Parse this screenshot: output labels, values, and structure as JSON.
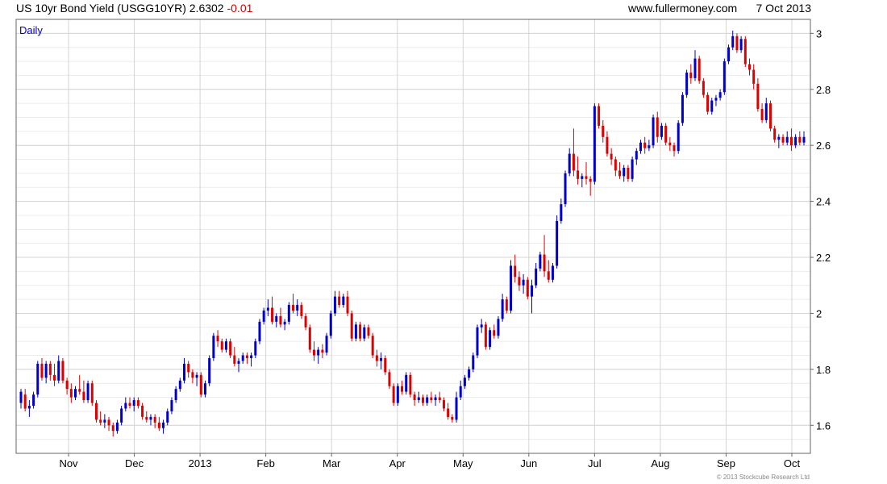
{
  "header": {
    "instrument": "US 10yr Bond Yield (USGG10YR)",
    "last": "2.6302",
    "change": "-0.01",
    "source": "www.fullermoney.com",
    "date": "7 Oct 2013"
  },
  "footer": {
    "copyright": "© 2013 Stockcube Research Ltd"
  },
  "colors": {
    "up": "#0000cc",
    "down": "#dd0000",
    "grid": "#d4d4d4",
    "gridMinor": "#ececec",
    "frame": "#666666",
    "label": "#0000cc"
  },
  "chart_data": {
    "type": "candlestick",
    "panel_label": "Daily",
    "x_tick_labels": [
      "Nov",
      "Dec",
      "2013",
      "Feb",
      "Mar",
      "Apr",
      "May",
      "Jun",
      "Jul",
      "Aug",
      "Sep",
      "Oct"
    ],
    "y_ticks": [
      "1.6",
      "1.8",
      "2",
      "2.2",
      "2.4",
      "2.6",
      "2.8",
      "3"
    ],
    "ylim": [
      1.5,
      3.05
    ],
    "y_axis_side": "right",
    "grid": true,
    "series": [
      {
        "name": "daily",
        "values": [
          [
            1.68,
            1.73,
            1.66,
            1.72
          ],
          [
            1.71,
            1.73,
            1.65,
            1.66
          ],
          [
            1.66,
            1.69,
            1.63,
            1.67
          ],
          [
            1.67,
            1.72,
            1.66,
            1.71
          ],
          [
            1.71,
            1.83,
            1.7,
            1.82
          ],
          [
            1.82,
            1.84,
            1.76,
            1.77
          ],
          [
            1.77,
            1.83,
            1.75,
            1.82
          ],
          [
            1.82,
            1.83,
            1.76,
            1.78
          ],
          [
            1.78,
            1.82,
            1.74,
            1.76
          ],
          [
            1.76,
            1.85,
            1.75,
            1.83
          ],
          [
            1.83,
            1.84,
            1.75,
            1.76
          ],
          [
            1.76,
            1.77,
            1.71,
            1.73
          ],
          [
            1.73,
            1.75,
            1.68,
            1.7
          ],
          [
            1.7,
            1.74,
            1.69,
            1.73
          ],
          [
            1.73,
            1.78,
            1.71,
            1.72
          ],
          [
            1.72,
            1.76,
            1.68,
            1.69
          ],
          [
            1.69,
            1.76,
            1.68,
            1.75
          ],
          [
            1.75,
            1.76,
            1.67,
            1.68
          ],
          [
            1.68,
            1.69,
            1.61,
            1.62
          ],
          [
            1.62,
            1.65,
            1.6,
            1.61
          ],
          [
            1.61,
            1.64,
            1.59,
            1.62
          ],
          [
            1.62,
            1.63,
            1.58,
            1.6
          ],
          [
            1.6,
            1.61,
            1.56,
            1.58
          ],
          [
            1.58,
            1.62,
            1.57,
            1.61
          ],
          [
            1.61,
            1.67,
            1.6,
            1.66
          ],
          [
            1.66,
            1.7,
            1.65,
            1.68
          ],
          [
            1.68,
            1.7,
            1.66,
            1.67
          ],
          [
            1.67,
            1.7,
            1.65,
            1.69
          ],
          [
            1.69,
            1.7,
            1.66,
            1.67
          ],
          [
            1.67,
            1.68,
            1.62,
            1.63
          ],
          [
            1.63,
            1.65,
            1.61,
            1.62
          ],
          [
            1.62,
            1.64,
            1.6,
            1.63
          ],
          [
            1.63,
            1.64,
            1.59,
            1.61
          ],
          [
            1.61,
            1.63,
            1.58,
            1.59
          ],
          [
            1.59,
            1.62,
            1.57,
            1.61
          ],
          [
            1.61,
            1.66,
            1.6,
            1.65
          ],
          [
            1.65,
            1.7,
            1.64,
            1.69
          ],
          [
            1.69,
            1.74,
            1.68,
            1.73
          ],
          [
            1.73,
            1.77,
            1.72,
            1.76
          ],
          [
            1.76,
            1.84,
            1.75,
            1.82
          ],
          [
            1.82,
            1.83,
            1.77,
            1.79
          ],
          [
            1.79,
            1.8,
            1.75,
            1.77
          ],
          [
            1.77,
            1.79,
            1.74,
            1.78
          ],
          [
            1.78,
            1.79,
            1.7,
            1.71
          ],
          [
            1.71,
            1.76,
            1.7,
            1.75
          ],
          [
            1.75,
            1.85,
            1.74,
            1.84
          ],
          [
            1.84,
            1.93,
            1.83,
            1.92
          ],
          [
            1.92,
            1.94,
            1.88,
            1.9
          ],
          [
            1.9,
            1.91,
            1.86,
            1.87
          ],
          [
            1.87,
            1.91,
            1.86,
            1.9
          ],
          [
            1.9,
            1.91,
            1.84,
            1.85
          ],
          [
            1.85,
            1.88,
            1.81,
            1.82
          ],
          [
            1.82,
            1.84,
            1.79,
            1.83
          ],
          [
            1.83,
            1.86,
            1.82,
            1.85
          ],
          [
            1.85,
            1.86,
            1.82,
            1.84
          ],
          [
            1.84,
            1.86,
            1.81,
            1.85
          ],
          [
            1.85,
            1.91,
            1.84,
            1.9
          ],
          [
            1.9,
            1.98,
            1.89,
            1.97
          ],
          [
            1.97,
            2.02,
            1.96,
            2.01
          ],
          [
            2.01,
            2.05,
            1.99,
            2.02
          ],
          [
            2.02,
            2.06,
            1.96,
            1.97
          ],
          [
            1.97,
            2.0,
            1.95,
            1.99
          ],
          [
            1.99,
            2.02,
            1.95,
            1.96
          ],
          [
            1.96,
            1.98,
            1.94,
            1.97
          ],
          [
            1.97,
            2.04,
            1.96,
            2.03
          ],
          [
            2.03,
            2.07,
            2.0,
            2.01
          ],
          [
            2.01,
            2.05,
            1.99,
            2.03
          ],
          [
            2.03,
            2.04,
            1.98,
            1.99
          ],
          [
            1.99,
            2.0,
            1.94,
            1.95
          ],
          [
            1.95,
            1.96,
            1.86,
            1.87
          ],
          [
            1.87,
            1.9,
            1.83,
            1.85
          ],
          [
            1.85,
            1.88,
            1.82,
            1.87
          ],
          [
            1.87,
            1.89,
            1.84,
            1.86
          ],
          [
            1.86,
            1.93,
            1.85,
            1.92
          ],
          [
            1.92,
            2.01,
            1.91,
            2.0
          ],
          [
            2.0,
            2.08,
            1.99,
            2.06
          ],
          [
            2.06,
            2.08,
            2.02,
            2.03
          ],
          [
            2.03,
            2.07,
            2.02,
            2.06
          ],
          [
            2.06,
            2.08,
            1.99,
            2.0
          ],
          [
            2.0,
            2.01,
            1.9,
            1.91
          ],
          [
            1.91,
            1.97,
            1.9,
            1.96
          ],
          [
            1.96,
            1.97,
            1.9,
            1.91
          ],
          [
            1.91,
            1.96,
            1.9,
            1.95
          ],
          [
            1.95,
            1.96,
            1.91,
            1.92
          ],
          [
            1.92,
            1.93,
            1.84,
            1.85
          ],
          [
            1.85,
            1.87,
            1.81,
            1.83
          ],
          [
            1.83,
            1.86,
            1.8,
            1.84
          ],
          [
            1.84,
            1.85,
            1.78,
            1.79
          ],
          [
            1.79,
            1.8,
            1.73,
            1.74
          ],
          [
            1.74,
            1.75,
            1.67,
            1.68
          ],
          [
            1.68,
            1.75,
            1.67,
            1.74
          ],
          [
            1.74,
            1.76,
            1.71,
            1.72
          ],
          [
            1.72,
            1.79,
            1.71,
            1.78
          ],
          [
            1.78,
            1.79,
            1.7,
            1.71
          ],
          [
            1.71,
            1.72,
            1.67,
            1.69
          ],
          [
            1.69,
            1.72,
            1.68,
            1.7
          ],
          [
            1.7,
            1.71,
            1.67,
            1.68
          ],
          [
            1.68,
            1.71,
            1.67,
            1.7
          ],
          [
            1.7,
            1.72,
            1.68,
            1.69
          ],
          [
            1.69,
            1.71,
            1.67,
            1.7
          ],
          [
            1.7,
            1.72,
            1.68,
            1.69
          ],
          [
            1.69,
            1.7,
            1.65,
            1.66
          ],
          [
            1.66,
            1.68,
            1.62,
            1.63
          ],
          [
            1.63,
            1.64,
            1.61,
            1.62
          ],
          [
            1.62,
            1.72,
            1.61,
            1.7
          ],
          [
            1.7,
            1.76,
            1.69,
            1.74
          ],
          [
            1.74,
            1.78,
            1.73,
            1.77
          ],
          [
            1.77,
            1.81,
            1.76,
            1.8
          ],
          [
            1.8,
            1.86,
            1.79,
            1.85
          ],
          [
            1.85,
            1.96,
            1.84,
            1.95
          ],
          [
            1.95,
            1.98,
            1.93,
            1.96
          ],
          [
            1.96,
            1.97,
            1.87,
            1.88
          ],
          [
            1.88,
            1.95,
            1.87,
            1.94
          ],
          [
            1.94,
            1.96,
            1.91,
            1.92
          ],
          [
            1.92,
            1.99,
            1.91,
            1.98
          ],
          [
            1.98,
            2.07,
            1.97,
            2.05
          ],
          [
            2.05,
            2.06,
            2.0,
            2.01
          ],
          [
            2.01,
            2.19,
            2.0,
            2.17
          ],
          [
            2.17,
            2.21,
            2.11,
            2.13
          ],
          [
            2.13,
            2.15,
            2.08,
            2.1
          ],
          [
            2.1,
            2.14,
            2.07,
            2.12
          ],
          [
            2.12,
            2.13,
            2.05,
            2.06
          ],
          [
            2.06,
            2.12,
            2.0,
            2.1
          ],
          [
            2.1,
            2.18,
            2.09,
            2.16
          ],
          [
            2.16,
            2.22,
            2.15,
            2.21
          ],
          [
            2.21,
            2.28,
            2.13,
            2.15
          ],
          [
            2.15,
            2.19,
            2.11,
            2.12
          ],
          [
            2.12,
            2.18,
            2.11,
            2.17
          ],
          [
            2.17,
            2.35,
            2.16,
            2.33
          ],
          [
            2.33,
            2.41,
            2.32,
            2.39
          ],
          [
            2.39,
            2.51,
            2.38,
            2.5
          ],
          [
            2.5,
            2.59,
            2.49,
            2.57
          ],
          [
            2.57,
            2.66,
            2.49,
            2.51
          ],
          [
            2.51,
            2.56,
            2.46,
            2.48
          ],
          [
            2.48,
            2.5,
            2.45,
            2.49
          ],
          [
            2.49,
            2.54,
            2.46,
            2.48
          ],
          [
            2.48,
            2.49,
            2.42,
            2.47
          ],
          [
            2.47,
            2.75,
            2.46,
            2.74
          ],
          [
            2.74,
            2.75,
            2.66,
            2.67
          ],
          [
            2.67,
            2.69,
            2.61,
            2.63
          ],
          [
            2.63,
            2.65,
            2.56,
            2.57
          ],
          [
            2.57,
            2.59,
            2.53,
            2.55
          ],
          [
            2.55,
            2.56,
            2.49,
            2.51
          ],
          [
            2.51,
            2.54,
            2.48,
            2.49
          ],
          [
            2.49,
            2.53,
            2.47,
            2.52
          ],
          [
            2.52,
            2.53,
            2.47,
            2.48
          ],
          [
            2.48,
            2.56,
            2.47,
            2.55
          ],
          [
            2.55,
            2.59,
            2.53,
            2.58
          ],
          [
            2.58,
            2.62,
            2.57,
            2.61
          ],
          [
            2.61,
            2.63,
            2.57,
            2.59
          ],
          [
            2.59,
            2.62,
            2.58,
            2.6
          ],
          [
            2.6,
            2.71,
            2.59,
            2.7
          ],
          [
            2.7,
            2.72,
            2.61,
            2.63
          ],
          [
            2.63,
            2.68,
            2.62,
            2.67
          ],
          [
            2.67,
            2.68,
            2.6,
            2.61
          ],
          [
            2.61,
            2.63,
            2.58,
            2.6
          ],
          [
            2.6,
            2.61,
            2.56,
            2.58
          ],
          [
            2.58,
            2.69,
            2.57,
            2.68
          ],
          [
            2.68,
            2.79,
            2.67,
            2.78
          ],
          [
            2.78,
            2.87,
            2.77,
            2.86
          ],
          [
            2.86,
            2.89,
            2.82,
            2.84
          ],
          [
            2.84,
            2.94,
            2.83,
            2.91
          ],
          [
            2.91,
            2.92,
            2.82,
            2.83
          ],
          [
            2.83,
            2.84,
            2.77,
            2.78
          ],
          [
            2.78,
            2.79,
            2.71,
            2.72
          ],
          [
            2.72,
            2.77,
            2.71,
            2.76
          ],
          [
            2.76,
            2.78,
            2.74,
            2.77
          ],
          [
            2.77,
            2.8,
            2.76,
            2.79
          ],
          [
            2.79,
            2.91,
            2.78,
            2.9
          ],
          [
            2.9,
            2.96,
            2.89,
            2.95
          ],
          [
            2.95,
            3.01,
            2.94,
            2.99
          ],
          [
            2.99,
            3.0,
            2.93,
            2.94
          ],
          [
            2.94,
            2.99,
            2.93,
            2.98
          ],
          [
            2.98,
            2.99,
            2.88,
            2.89
          ],
          [
            2.89,
            2.91,
            2.85,
            2.87
          ],
          [
            2.87,
            2.89,
            2.8,
            2.82
          ],
          [
            2.82,
            2.84,
            2.72,
            2.73
          ],
          [
            2.73,
            2.75,
            2.68,
            2.69
          ],
          [
            2.69,
            2.77,
            2.68,
            2.75
          ],
          [
            2.75,
            2.76,
            2.65,
            2.66
          ],
          [
            2.66,
            2.67,
            2.61,
            2.62
          ],
          [
            2.62,
            2.64,
            2.59,
            2.63
          ],
          [
            2.63,
            2.64,
            2.6,
            2.61
          ],
          [
            2.61,
            2.65,
            2.6,
            2.63
          ],
          [
            2.63,
            2.66,
            2.58,
            2.6
          ],
          [
            2.6,
            2.64,
            2.59,
            2.63
          ],
          [
            2.63,
            2.65,
            2.6,
            2.61
          ],
          [
            2.61,
            2.65,
            2.6,
            2.63
          ]
        ]
      }
    ]
  }
}
